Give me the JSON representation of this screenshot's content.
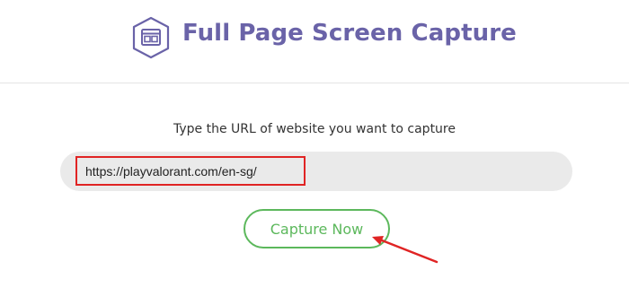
{
  "header": {
    "title": "Full Page Screen Capture",
    "logo_icon": "browser-window-icon",
    "brand_color": "#6a63a8"
  },
  "form": {
    "prompt": "Type the URL of website you want to capture",
    "url_value": "https://playvalorant.com/en-sg/",
    "button_label": "Capture Now",
    "button_color": "#5cb85c"
  },
  "annotations": {
    "highlight_color": "#e02424",
    "arrow_color": "#e02424"
  }
}
